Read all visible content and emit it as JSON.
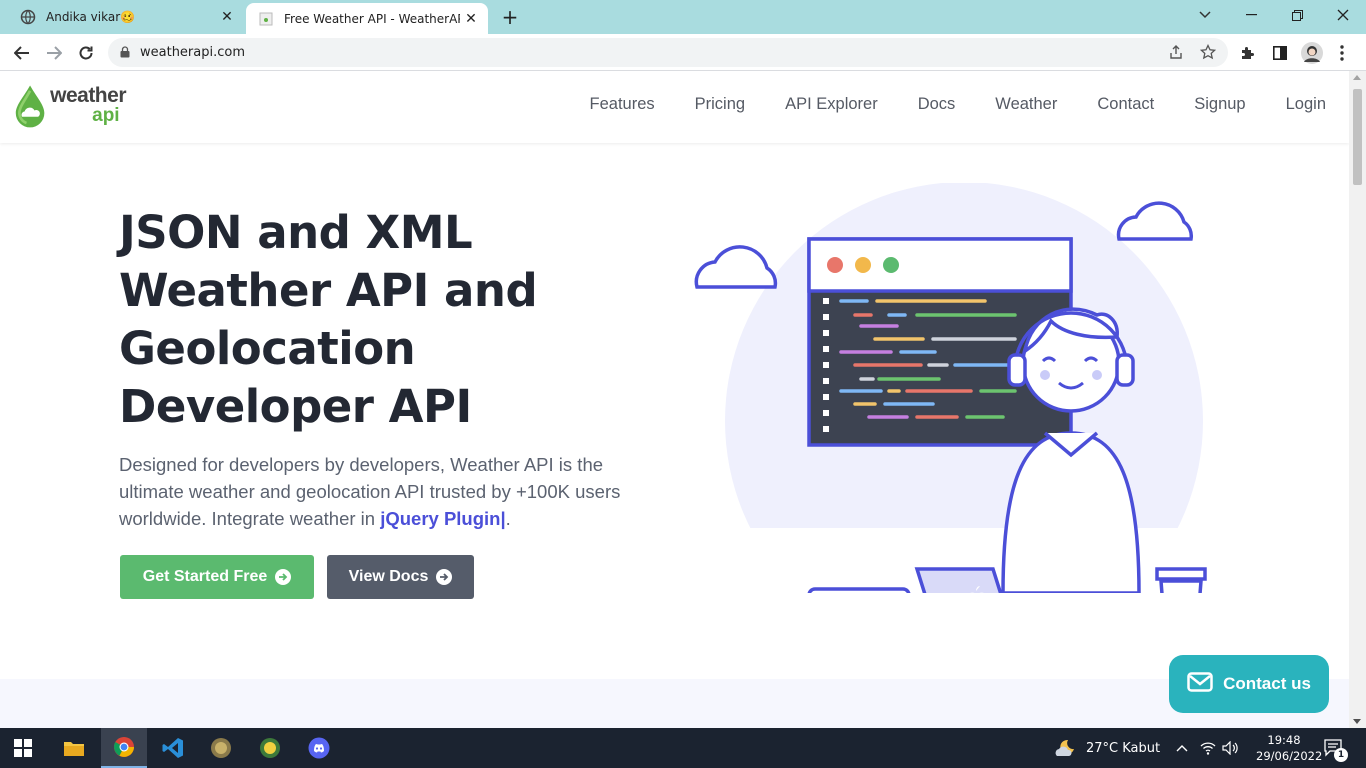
{
  "browser": {
    "tabs": [
      {
        "title": "Andika vikar🥴",
        "active": false
      },
      {
        "title": "Free Weather API - WeatherAPI.c",
        "active": true
      }
    ],
    "url": "weatherapi.com"
  },
  "site": {
    "logo": {
      "word1": "weather",
      "word2": "api"
    },
    "nav": [
      "Features",
      "Pricing",
      "API Explorer",
      "Docs",
      "Weather",
      "Contact",
      "Signup",
      "Login"
    ],
    "hero": {
      "title_lines": [
        "JSON and XML",
        "Weather API and",
        "Geolocation",
        "Developer API"
      ],
      "desc_before": "Designed for developers by developers, Weather API is the ultimate weather and geolocation API trusted by +100K users worldwide. Integrate weather in ",
      "desc_highlight": "jQuery Plugin|",
      "desc_after": ".",
      "btn_primary": "Get Started Free",
      "btn_secondary": "View Docs"
    },
    "contact_button": "Contact us"
  },
  "taskbar": {
    "weather": "27°C  Kabut",
    "time": "19:48",
    "date": "29/06/2022",
    "notifications": "1"
  },
  "colors": {
    "tab_strip": "#a9dcdf",
    "primary_green": "#5bba6f",
    "secondary_gray": "#555c6a",
    "accent_purple": "#4b4fd8",
    "contact_teal": "#2ab3bd"
  }
}
